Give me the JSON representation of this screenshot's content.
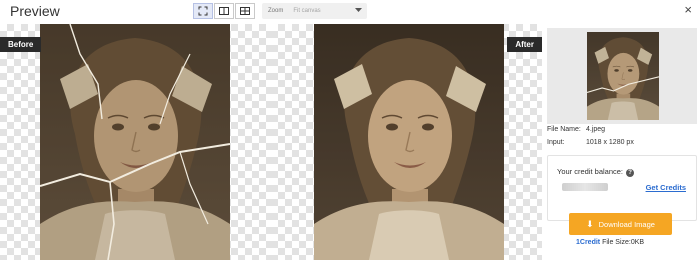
{
  "header": {
    "title": "Preview",
    "zoom_label": "Zoom",
    "zoom_value": "Fit canvas",
    "view_modes": [
      "fullscreen-icon",
      "split-view-icon",
      "grid-view-icon"
    ],
    "close_label": "×"
  },
  "compare": {
    "before_label": "Before",
    "after_label": "After"
  },
  "file": {
    "name_key": "File Name:",
    "name_value": "4.jpeg",
    "input_key": "Input:",
    "input_value": "1018 x 1280 px"
  },
  "credits": {
    "balance_label": "Your credit balance:",
    "help_icon": "?",
    "get_credits": "Get Credits"
  },
  "download": {
    "label": "Download Image",
    "credit_cost": "1Credit",
    "file_size": "File Size:0KB"
  },
  "colors": {
    "accent_orange": "#f5a623",
    "link_blue": "#2b6cd0",
    "tag_dark": "#2a2a2a"
  }
}
